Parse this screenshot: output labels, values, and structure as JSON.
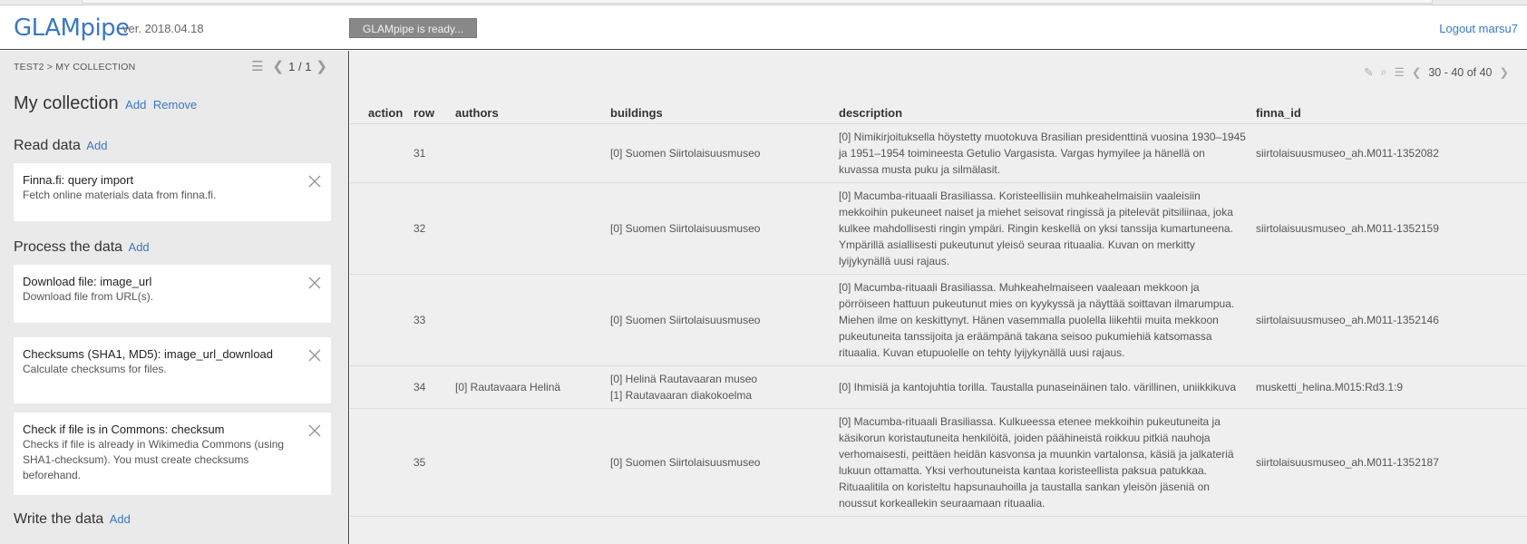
{
  "app": {
    "brand": "GLAMpipe",
    "version": "ver. 2018.04.18",
    "status": "GLAMpipe is ready...",
    "logout": "Logout marsu7"
  },
  "sidebar": {
    "breadcrumb": "TEST2 > MY COLLECTION",
    "pager": "1 / 1",
    "collection_title": "My collection",
    "add_label": "Add",
    "remove_label": "Remove",
    "sections": {
      "read": {
        "title": "Read data",
        "add": "Add"
      },
      "process": {
        "title": "Process the data",
        "add": "Add"
      },
      "write": {
        "title": "Write the data",
        "add": "Add"
      }
    },
    "nodes": [
      {
        "title": "Finna.fi: query import",
        "desc": "Fetch online materials data from finna.fi."
      },
      {
        "title": "Download file: image_url",
        "desc": "Download file from URL(s)."
      },
      {
        "title": "Checksums (SHA1, MD5): image_url_download",
        "desc": "Calculate checksums for files."
      },
      {
        "title": "Check if file is in Commons: checksum",
        "desc": "Checks if file is already in Wikimedia Commons (using SHA1-checksum). You must create checksums beforehand."
      }
    ]
  },
  "main": {
    "pager": "30 - 40 of 40",
    "columns": [
      "action",
      "row",
      "authors",
      "buildings",
      "description",
      "finna_id"
    ],
    "rows": [
      {
        "row": "31",
        "authors": "",
        "buildings": [
          "[0] Suomen Siirtolaisuusmuseo"
        ],
        "description": "[0] Nimikirjoituksella höystetty muotokuva Brasilian presidenttinä vuosina 1930–1945 ja 1951–1954 toimineesta Getulio Vargasista. Vargas hymyilee ja hänellä on kuvassa musta puku ja silmälasit.",
        "finna_id": "siirtolaisuusmuseo_ah.M011-1352082"
      },
      {
        "row": "32",
        "authors": "",
        "buildings": [
          "[0] Suomen Siirtolaisuusmuseo"
        ],
        "description": "[0] Macumba-rituaali Brasiliassa. Koristeellisiin muhkeahelmaisiin vaaleisiin mekkoihin pukeuneet naiset ja miehet seisovat ringissä ja pitelevät pitsiliinaa, joka kulkee mahdollisesti ringin ympäri. Ringin keskellä on yksi tanssija kumartuneena. Ympärillä asiallisesti pukeutunut yleisö seuraa rituaalia. Kuvan on merkitty lyijykynällä uusi rajaus.",
        "finna_id": "siirtolaisuusmuseo_ah.M011-1352159"
      },
      {
        "row": "33",
        "authors": "",
        "buildings": [
          "[0] Suomen Siirtolaisuusmuseo"
        ],
        "description": "[0] Macumba-rituaali Brasiliassa. Muhkeahelmaiseen vaaleaan mekkoon ja pörröiseen hattuun pukeutunut mies on kyykyssä ja näyttää soittavan ilmarumpua. Miehen ilme on keskittynyt. Hänen vasemmalla puolella liikehtii muita mekkoon pukeutuneita tanssijoita ja eräämpänä takana seisoo pukumiehiä katsomassa rituaalia. Kuvan etupuolelle on tehty lyijykynällä uusi rajaus.",
        "finna_id": "siirtolaisuusmuseo_ah.M011-1352146"
      },
      {
        "row": "34",
        "authors": "[0] Rautavaara Helinä",
        "buildings": [
          "[0] Helinä Rautavaaran museo",
          "[1] Rautavaaran diakokoelma"
        ],
        "description": "[0] Ihmisiä ja kantojuhtia torilla. Taustalla punaseinäinen talo. värillinen, uniikkikuva",
        "finna_id": "musketti_helina.M015:Rd3.1:9"
      },
      {
        "row": "35",
        "authors": "",
        "buildings": [
          "[0] Suomen Siirtolaisuusmuseo"
        ],
        "description": "[0] Macumba-rituaali Brasiliassa. Kulkueessa etenee mekkoihin pukeutuneita ja käsikorun koristautuneita henkilöitä, joiden päähineistä roikkuu pitkiä nauhoja verhomaisesti, peittäen heidän kasvonsa ja muunkin vartalonsa, käsiä ja jalkateriä lukuun ottamatta. Yksi verhoutuneista kantaa koristeellista paksua patukkaa. Rituaalitila on koristeltu hapsunauhoilla ja taustalla sankan yleisön jäseniä on noussut korkeallekin seuraamaan rituaalia.",
        "finna_id": "siirtolaisuusmuseo_ah.M011-1352187"
      }
    ]
  }
}
